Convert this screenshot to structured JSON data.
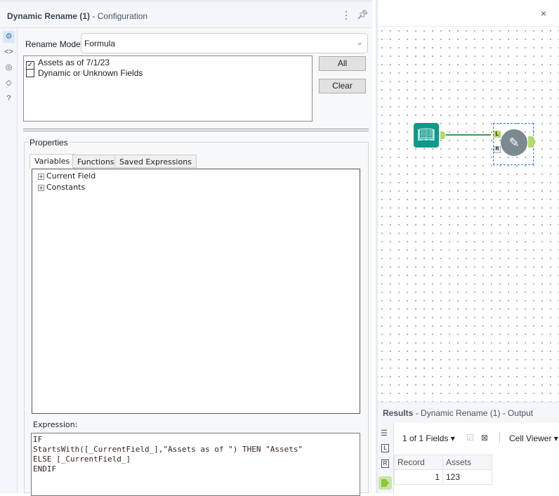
{
  "config": {
    "tool_name": "Dynamic Rename (1)",
    "suffix": " - Configuration",
    "rename_mode_label": "Rename Mode:",
    "rename_mode_value": "Formula",
    "fields": [
      {
        "label": "Assets as of 7/1/23",
        "checked": true
      },
      {
        "label": "Dynamic or Unknown Fields",
        "checked": false
      }
    ],
    "all_button": "All",
    "clear_button": "Clear",
    "properties_label": "Properties",
    "tabs": [
      "Variables",
      "Functions",
      "Saved Expressions"
    ],
    "tree": [
      "Current Field",
      "Constants"
    ],
    "expression_label": "Expression:",
    "expression_lines": [
      "IF",
      "StartsWith([_CurrentField_],\"Assets as of \") THEN \"Assets\"",
      "ELSE [_CurrentField_]",
      "ENDIF"
    ]
  },
  "canvas": {
    "close": "×",
    "anchor_l": "L",
    "anchor_r": "R"
  },
  "results": {
    "title": "Results",
    "subtitle": " - Dynamic Rename (1) - Output",
    "fields_selector": "1 of 1 Fields",
    "viewer": "Cell Viewer",
    "columns": [
      "Record",
      "Assets"
    ],
    "rows": [
      [
        "1",
        "123"
      ]
    ],
    "side_l": "L",
    "side_r": "R"
  },
  "colors": {
    "accent": "#0e9a8a",
    "anchor": "#b5d96a"
  }
}
